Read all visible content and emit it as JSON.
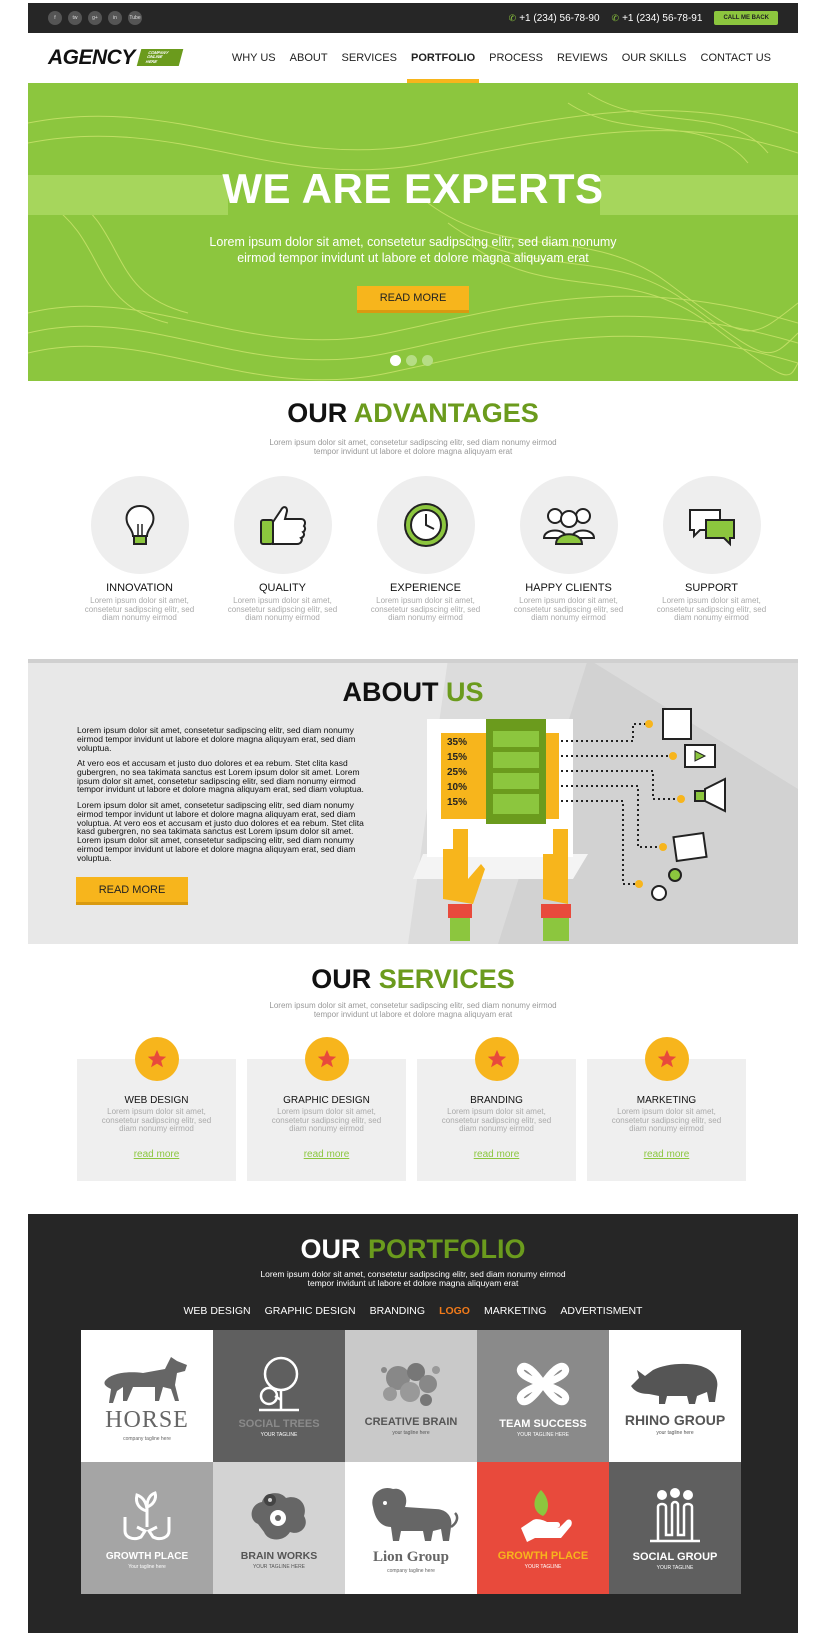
{
  "topbar": {
    "social": [
      "f",
      "tw",
      "g+",
      "in",
      "Tube"
    ],
    "phone1": "+1 (234) 56-78-90",
    "phone2": "+1 (234) 56-78-91",
    "call_label": "CALL ME BACK"
  },
  "header": {
    "logo": "AGENCY",
    "logo_tagline": "COMPANY ONLINE HERE",
    "nav": [
      {
        "label": "WHY US",
        "active": false
      },
      {
        "label": "ABOUT",
        "active": false
      },
      {
        "label": "SERVICES",
        "active": false
      },
      {
        "label": "PORTFOLIO",
        "active": true
      },
      {
        "label": "PROCESS",
        "active": false
      },
      {
        "label": "REVIEWS",
        "active": false
      },
      {
        "label": "OUR SKILLS",
        "active": false
      },
      {
        "label": "CONTACT US",
        "active": false
      }
    ]
  },
  "hero": {
    "title": "WE ARE EXPERTS",
    "subtitle_line1": "Lorem ipsum dolor sit amet, consetetur sadipscing elitr, sed diam nonumy",
    "subtitle_line2": "eirmod tempor invidunt ut labore et dolore magna aliquyam erat",
    "button": "READ MORE",
    "slides": 3,
    "active_slide": 1
  },
  "advantages": {
    "title_a": "OUR",
    "title_b": "ADVANTAGES",
    "sub_line1": "Lorem ipsum dolor sit amet, consetetur sadipscing elitr, sed diam nonumy eirmod",
    "sub_line2": "tempor invidunt ut labore et dolore magna aliquyam erat",
    "items": [
      {
        "title": "INNOVATION",
        "icon": "lightbulb-icon",
        "text": "Lorem ipsum dolor sit amet, consetetur sadipscing elitr, sed diam nonumy eirmod"
      },
      {
        "title": "QUALITY",
        "icon": "thumbs-up-icon",
        "text": "Lorem ipsum dolor sit amet, consetetur sadipscing elitr, sed diam nonumy eirmod"
      },
      {
        "title": "EXPERIENCE",
        "icon": "clock-icon",
        "text": "Lorem ipsum dolor sit amet, consetetur sadipscing elitr, sed diam nonumy eirmod"
      },
      {
        "title": "HAPPY CLIENTS",
        "icon": "people-icon",
        "text": "Lorem ipsum dolor sit amet, consetetur sadipscing elitr, sed diam nonumy eirmod"
      },
      {
        "title": "SUPPORT",
        "icon": "chat-bubbles-icon",
        "text": "Lorem ipsum dolor sit amet, consetetur sadipscing elitr, sed diam nonumy eirmod"
      }
    ]
  },
  "about": {
    "title_a": "ABOUT",
    "title_b": "US",
    "p1": "Lorem ipsum dolor sit amet, consetetur sadipscing elitr, sed diam nonumy eirmod tempor invidunt ut labore et dolore magna aliquyam erat, sed diam voluptua.",
    "p2": "At vero eos et accusam et justo duo dolores et ea rebum. Stet clita kasd gubergren, no sea takimata sanctus est Lorem ipsum dolor sit amet. Lorem ipsum dolor sit amet, consetetur sadipscing elitr, sed diam nonumy eirmod tempor invidunt ut labore et dolore magna aliquyam erat, sed diam voluptua.",
    "p3": "Lorem ipsum dolor sit amet, consetetur sadipscing elitr, sed diam nonumy eirmod tempor invidunt ut labore et dolore magna aliquyam erat, sed diam voluptua. At vero eos et accusam et justo duo dolores et ea rebum. Stet clita kasd gubergren, no sea takimata sanctus est Lorem ipsum dolor sit amet. Lorem ipsum dolor sit amet, consetetur sadipscing elitr, sed diam nonumy eirmod tempor invidunt ut labore et dolore magna aliquyam erat, sed diam voluptua.",
    "button": "READ MORE",
    "percentages": [
      "35%",
      "15%",
      "25%",
      "10%",
      "15%"
    ]
  },
  "services": {
    "title_a": "OUR",
    "title_b": "SERVICES",
    "sub_line1": "Lorem ipsum dolor sit amet, consetetur sadipscing elitr, sed diam nonumy eirmod",
    "sub_line2": "tempor invidunt ut labore et dolore magna aliquyam erat",
    "items": [
      {
        "title": "WEB DESIGN",
        "text": "Lorem ipsum dolor sit amet, consetetur sadipscing elitr, sed diam nonumy eirmod",
        "link": "read more"
      },
      {
        "title": "GRAPHIC DESIGN",
        "text": "Lorem ipsum dolor sit amet, consetetur sadipscing elitr, sed diam nonumy eirmod",
        "link": "read more"
      },
      {
        "title": "BRANDING",
        "text": "Lorem ipsum dolor sit amet, consetetur sadipscing elitr, sed diam nonumy eirmod",
        "link": "read more"
      },
      {
        "title": "MARKETING",
        "text": "Lorem ipsum dolor sit amet, consetetur sadipscing elitr, sed diam nonumy eirmod",
        "link": "read more"
      }
    ]
  },
  "portfolio": {
    "title_a": "OUR",
    "title_b": "PORTFOLIO",
    "sub_line1": "Lorem ipsum dolor sit amet, consetetur sadipscing elitr, sed diam nonumy eirmod",
    "sub_line2": "tempor invidunt ut labore et dolore magna aliquyam erat",
    "filters": [
      {
        "label": "WEB DESIGN",
        "active": false
      },
      {
        "label": "GRAPHIC DESIGN",
        "active": false
      },
      {
        "label": "BRANDING",
        "active": false
      },
      {
        "label": "LOGO",
        "active": true
      },
      {
        "label": "MARKETING",
        "active": false
      },
      {
        "label": "ADVERTISMENT",
        "active": false
      }
    ],
    "tiles": [
      {
        "name": "HORSE",
        "tag": "company tagline here",
        "icon": "horse-icon",
        "bg": "#ffffff",
        "fg": "#666666"
      },
      {
        "name": "SOCIAL TREES",
        "tag": "YOUR TAGLINE",
        "icon": "tree-icon",
        "bg": "#5f5f5f",
        "fg": "#8a8a8a"
      },
      {
        "name": "CREATIVE BRAIN",
        "tag": "your tagline here",
        "icon": "bubbles-brain-icon",
        "bg": "#c9c9c9",
        "fg": "#555555"
      },
      {
        "name": "TEAM SUCCESS",
        "tag": "YOUR TAGLINE HERE",
        "icon": "clover-icon",
        "bg": "#8a8a8a",
        "fg": "#ffffff"
      },
      {
        "name": "RHINO GROUP",
        "tag": "your tagline here",
        "icon": "rhino-icon",
        "bg": "#ffffff",
        "fg": "#555555"
      },
      {
        "name": "GROWTH PLACE",
        "tag": "Your tagline here",
        "icon": "hands-plant-icon",
        "bg": "#a5a5a5",
        "fg": "#ffffff"
      },
      {
        "name": "BRAIN WORKS",
        "tag": "YOUR TAGLINE HERE",
        "icon": "brain-gear-icon",
        "bg": "#d3d3d3",
        "fg": "#555555"
      },
      {
        "name": "Lion Group",
        "tag": "company tagline here",
        "icon": "lion-icon",
        "bg": "#ffffff",
        "fg": "#666666"
      },
      {
        "name": "GROWTH PLACE",
        "tag": "YOUR TAGLINE",
        "icon": "hand-leaf-icon",
        "bg": "#e84a3c",
        "fg": "#ffffff",
        "accent": "#f7b51c"
      },
      {
        "name": "SOCIAL GROUP",
        "tag": "YOUR TAGLINE",
        "icon": "people-group-icon",
        "bg": "#5f5f5f",
        "fg": "#ffffff"
      }
    ]
  },
  "colors": {
    "green": "#8cc63e",
    "dark_green": "#6b9b1d",
    "yellow": "#f7b51c",
    "dark": "#262626",
    "orange": "#f07a1a",
    "red": "#e84a3c"
  }
}
